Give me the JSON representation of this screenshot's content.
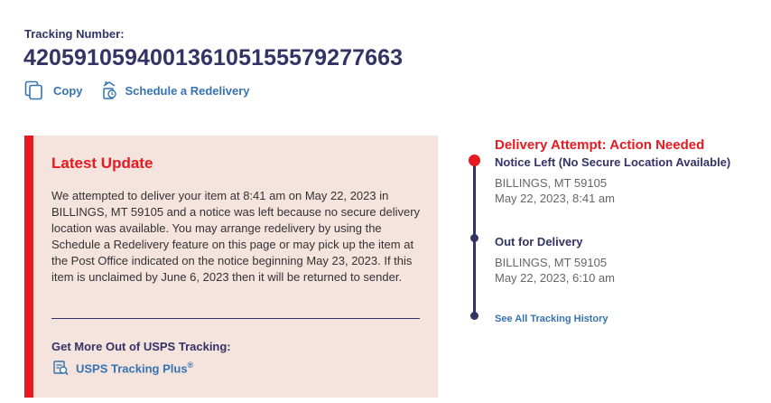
{
  "tracking": {
    "label": "Tracking Number:",
    "number": "420591059400136105155579277663"
  },
  "actions": {
    "copy_label": "Copy",
    "redelivery_label": "Schedule a Redelivery"
  },
  "latest_update": {
    "title": "Latest Update",
    "text": "We attempted to deliver your item at 8:41 am on May 22, 2023 in BILLINGS, MT 59105 and a notice was left because no secure delivery location was available. You may arrange redelivery by using the Schedule a Redelivery feature on this page or may pick up the item at the Post Office indicated on the notice beginning May 23, 2023. If this item is unclaimed by June 6, 2023 then it will be returned to sender.",
    "more_label": "Get More Out of USPS Tracking:",
    "plus_link": "USPS Tracking Plus",
    "plus_mark": "®"
  },
  "timeline": {
    "status": "Delivery Attempt: Action Needed",
    "events": [
      {
        "title": "Notice Left (No Secure Location Available)",
        "location": "BILLINGS, MT 59105",
        "datetime": "May 22, 2023, 8:41 am"
      },
      {
        "title": "Out for Delivery",
        "location": "BILLINGS, MT 59105",
        "datetime": "May 22, 2023, 6:10 am"
      }
    ],
    "history_link": "See All Tracking History"
  },
  "colors": {
    "navy": "#333366",
    "red": "#e71921",
    "link_blue": "#3573b1",
    "update_bg": "#f5e3dd"
  },
  "icons": [
    "copy-icon",
    "redelivery-icon",
    "tracking-plus-icon"
  ]
}
